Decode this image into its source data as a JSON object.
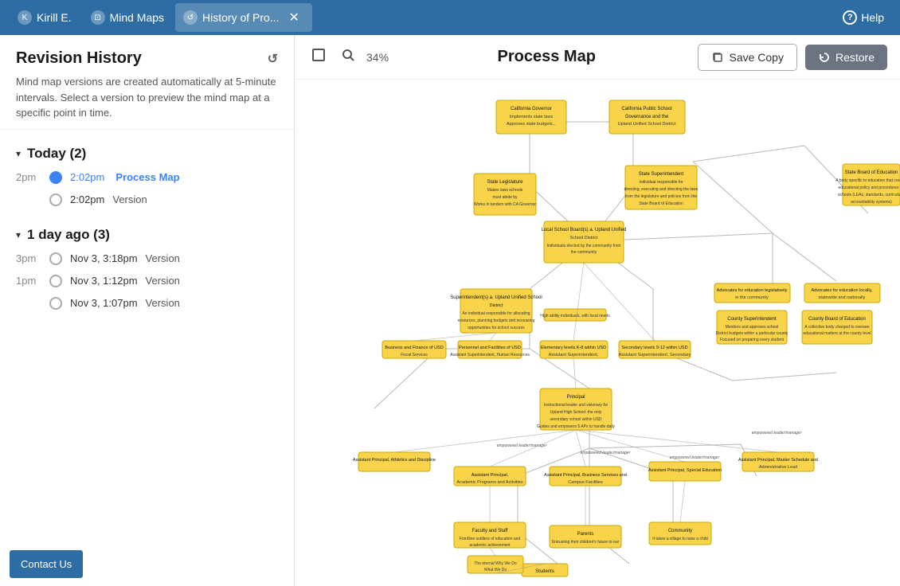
{
  "topnav": {
    "user_label": "Kirill E.",
    "mindmaps_label": "Mind Maps",
    "history_label": "History of Pro...",
    "help_label": "Help"
  },
  "sidebar": {
    "title": "Revision History",
    "description": "Mind map versions are created automatically at 5-minute intervals. Select a version to preview the mind map at a specific point in time.",
    "today_section": "Today (2)",
    "day_ago_section": "1 day ago (3)",
    "revisions_today": [
      {
        "time": "2pm",
        "timestamp": "2:02pm",
        "label": "Process Map",
        "type": "named"
      },
      {
        "time": "",
        "timestamp": "2:02pm",
        "label": "Version",
        "type": "plain"
      }
    ],
    "revisions_ago": [
      {
        "time": "3pm",
        "timestamp": "Nov 3, 3:18pm",
        "label": "Version",
        "type": "plain"
      },
      {
        "time": "1pm",
        "timestamp": "Nov 3, 1:12pm",
        "label": "Version",
        "type": "plain"
      },
      {
        "time": "",
        "timestamp": "Nov 3, 1:07pm",
        "label": "Version",
        "type": "plain"
      }
    ],
    "contact_us": "Contact Us"
  },
  "canvas": {
    "zoom": "34%",
    "title": "Process Map",
    "save_copy": "Save Copy",
    "restore": "Restore"
  }
}
